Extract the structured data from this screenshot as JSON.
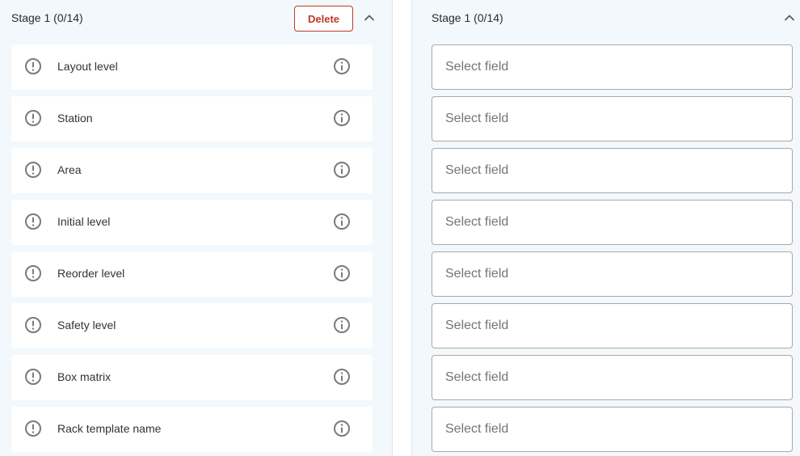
{
  "left_panel": {
    "stage_title": "Stage 1 (0/14)",
    "delete_label": "Delete",
    "rows": [
      {
        "label": "Layout level"
      },
      {
        "label": "Station"
      },
      {
        "label": "Area"
      },
      {
        "label": "Initial level"
      },
      {
        "label": "Reorder level"
      },
      {
        "label": "Safety level"
      },
      {
        "label": "Box matrix"
      },
      {
        "label": "Rack template name"
      }
    ]
  },
  "right_panel": {
    "stage_title": "Stage 1 (0/14)",
    "fields": [
      {
        "placeholder": "Select field"
      },
      {
        "placeholder": "Select field"
      },
      {
        "placeholder": "Select field"
      },
      {
        "placeholder": "Select field"
      },
      {
        "placeholder": "Select field"
      },
      {
        "placeholder": "Select field"
      },
      {
        "placeholder": "Select field"
      },
      {
        "placeholder": "Select field"
      }
    ]
  },
  "icons": {
    "row_status": "warning-circle-icon",
    "row_info": "info-icon",
    "collapse": "chevron-up-icon"
  },
  "colors": {
    "panel_bg": "#f2f8fb",
    "delete_accent": "#c0392b",
    "icon_gray": "#7a7a7a"
  }
}
